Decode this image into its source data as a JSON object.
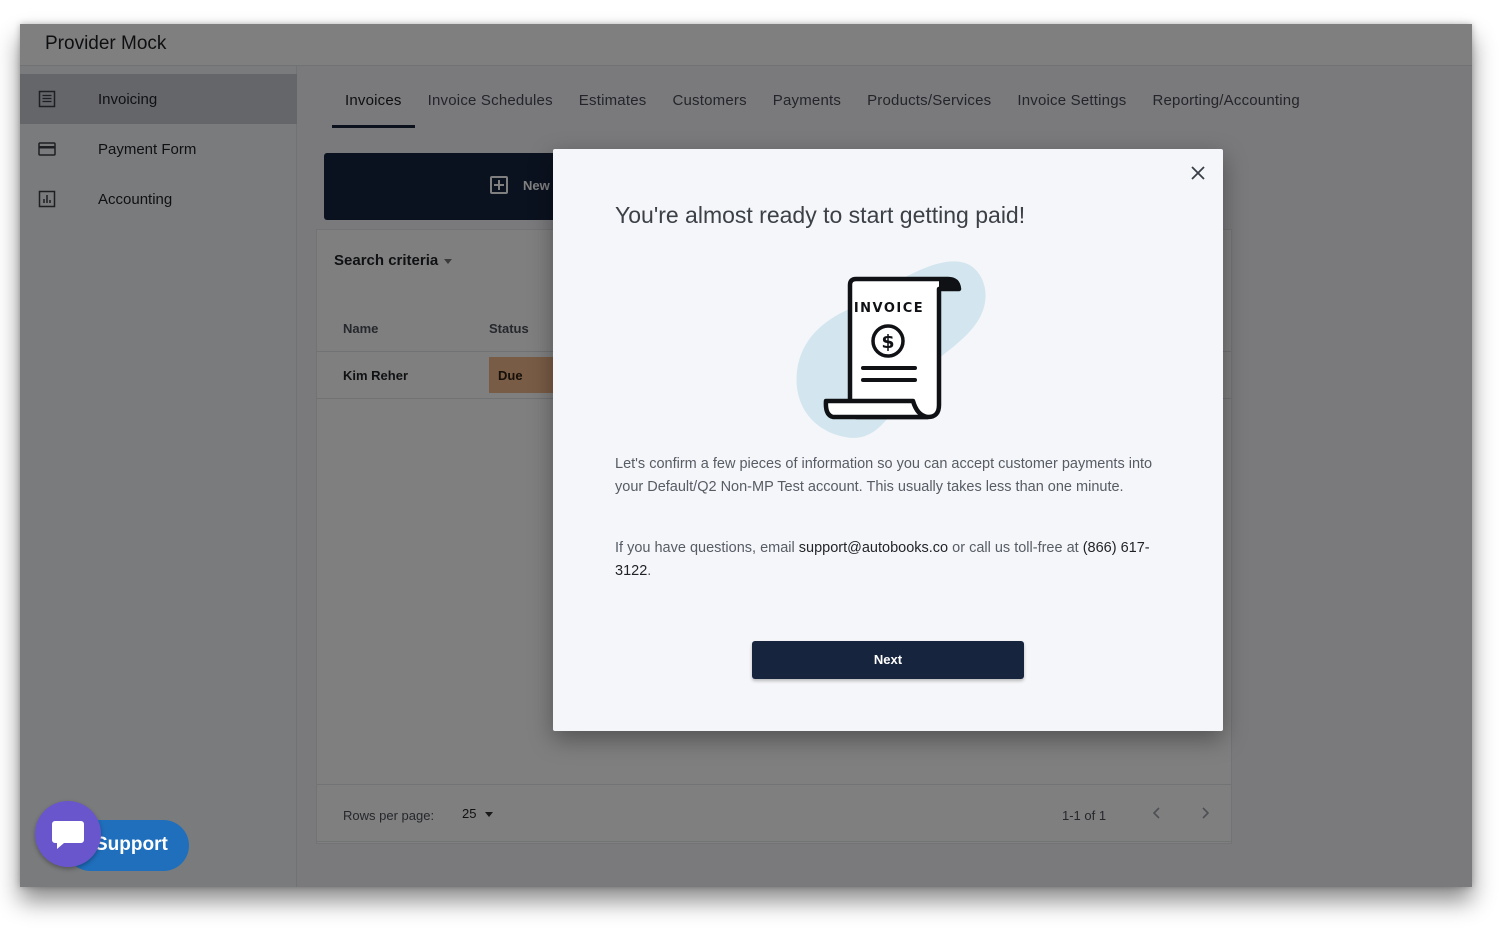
{
  "app": {
    "title": "Provider Mock"
  },
  "sidebar": {
    "items": [
      {
        "label": "Invoicing",
        "icon": "document-lines-icon",
        "active": true
      },
      {
        "label": "Payment Form",
        "icon": "credit-card-icon",
        "active": false
      },
      {
        "label": "Accounting",
        "icon": "bar-chart-icon",
        "active": false
      }
    ]
  },
  "tabs": [
    {
      "label": "Invoices",
      "active": true
    },
    {
      "label": "Invoice Schedules"
    },
    {
      "label": "Estimates"
    },
    {
      "label": "Customers"
    },
    {
      "label": "Payments"
    },
    {
      "label": "Products/Services"
    },
    {
      "label": "Invoice Settings"
    },
    {
      "label": "Reporting/Accounting"
    }
  ],
  "main": {
    "new_button_label": "New",
    "search_criteria_label": "Search criteria",
    "table": {
      "columns": [
        "Name",
        "Status"
      ],
      "rows": [
        {
          "name": "Kim Reher",
          "status": "Due"
        }
      ]
    },
    "footer": {
      "rows_per_page_label": "Rows per page:",
      "rows_per_page_value": "25",
      "page_info": "1-1 of 1"
    }
  },
  "modal": {
    "title": "You're almost ready to start getting paid!",
    "illustration_label": "INVOICE",
    "body_1": "Let's confirm a few pieces of information so you can accept customer payments into your Default/Q2 Non-MP Test account. This usually takes less than one minute.",
    "body_2_prefix": "If you have questions, email ",
    "support_email": "support@autobooks.co",
    "body_2_middle": " or call us toll-free at ",
    "support_phone": "(866) 617-3122",
    "body_2_suffix": ".",
    "next_button_label": "Next"
  },
  "support_widget": {
    "label": "Support"
  },
  "colors": {
    "brand_navy": "#16243e",
    "due_badge": "#f2b98a",
    "support_blue": "#1f6fbd",
    "support_purple": "#6a56cc",
    "illustration_blob": "#d3e6ef"
  }
}
